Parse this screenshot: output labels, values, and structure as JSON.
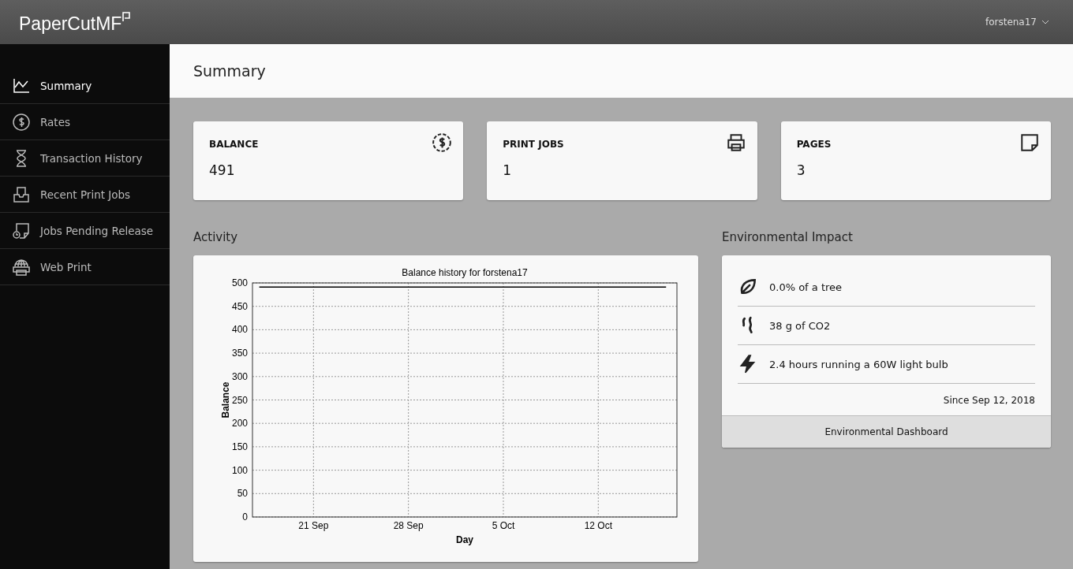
{
  "header": {
    "logo": "PaperCut",
    "logo_suffix": "MF",
    "user": "forstena17"
  },
  "sidebar": {
    "items": [
      {
        "label": "Summary",
        "selected": true
      },
      {
        "label": "Rates",
        "selected": false
      },
      {
        "label": "Transaction History",
        "selected": false
      },
      {
        "label": "Recent Print Jobs",
        "selected": false
      },
      {
        "label": "Jobs Pending Release",
        "selected": false
      },
      {
        "label": "Web Print",
        "selected": false
      }
    ]
  },
  "page_title": "Summary",
  "stats": [
    {
      "label": "BALANCE",
      "value": "491"
    },
    {
      "label": "PRINT JOBS",
      "value": "1"
    },
    {
      "label": "PAGES",
      "value": "3"
    }
  ],
  "activity": {
    "heading": "Activity",
    "chart_data": {
      "type": "line",
      "title": "Balance history for forstena17",
      "xlabel": "Day",
      "ylabel": "Balance",
      "categories": [
        null,
        null,
        null,
        null,
        "21 Sep",
        null,
        null,
        null,
        null,
        null,
        null,
        "28 Sep",
        null,
        null,
        null,
        null,
        null,
        null,
        "5 Oct",
        null,
        null,
        null,
        null,
        null,
        null,
        "12 Oct",
        null,
        null,
        null,
        null,
        null
      ],
      "series": [
        {
          "color": "#000000",
          "values": [
            491,
            491,
            491,
            491,
            491,
            491,
            491,
            491,
            491,
            491,
            491,
            491,
            491,
            491,
            491,
            491,
            491,
            491,
            491,
            491,
            491,
            491,
            491,
            491,
            491,
            491,
            491,
            491,
            491,
            491,
            491
          ]
        }
      ],
      "ylim": [
        0,
        500
      ],
      "grid": true,
      "yticks": [
        0,
        50,
        100,
        150,
        200,
        250,
        300,
        350,
        400,
        450,
        500
      ]
    }
  },
  "environment": {
    "heading": "Environmental Impact",
    "items": [
      {
        "text": "0.0% of a tree"
      },
      {
        "text": "38 g of CO2"
      },
      {
        "text": "2.4 hours running a 60W light bulb"
      }
    ],
    "since": "Since Sep 12, 2018",
    "button": "Environmental Dashboard"
  }
}
